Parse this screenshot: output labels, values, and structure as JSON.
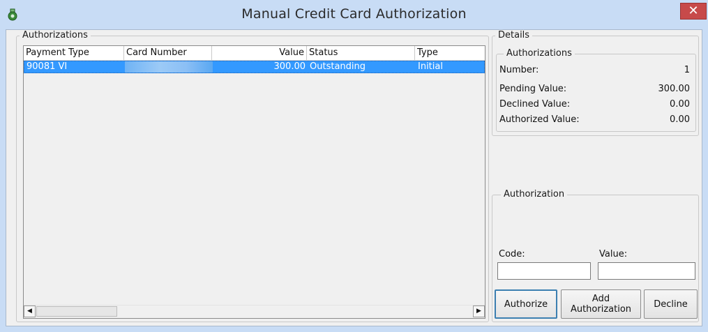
{
  "window": {
    "title": "Manual Credit Card Authorization",
    "close_glyph": "✕",
    "app_icon": "money-bag-icon"
  },
  "authorizations_group": {
    "label": "Authorizations",
    "columns": [
      "Payment Type",
      "Card Number",
      "Value",
      "Status",
      "Type"
    ],
    "rows": [
      {
        "payment_type": "90081 VI",
        "card_number": "",
        "value": "300.00",
        "status": "Outstanding",
        "type": "Initial",
        "selected": true
      }
    ],
    "scroll_left_glyph": "◀",
    "scroll_right_glyph": "▶"
  },
  "details": {
    "label": "Details",
    "summary": {
      "label": "Authorizations",
      "number_label": "Number:",
      "number_value": "1",
      "pending_label": "Pending Value:",
      "pending_value": "300.00",
      "declined_label": "Declined Value:",
      "declined_value": "0.00",
      "authorized_label": "Authorized Value:",
      "authorized_value": "0.00"
    },
    "authorization": {
      "label": "Authorization",
      "code_label": "Code:",
      "code_value": "",
      "value_label": "Value:",
      "value_value": ""
    }
  },
  "buttons": {
    "authorize": "Authorize",
    "add_authorization_line1": "Add",
    "add_authorization_line2": "Authorization",
    "decline": "Decline"
  },
  "colors": {
    "selection": "#3399ff",
    "title_bar": "#c8dcf5",
    "close_button": "#c74a4a"
  }
}
